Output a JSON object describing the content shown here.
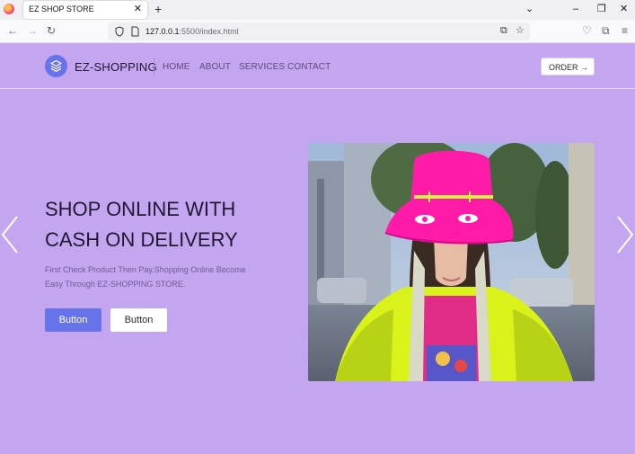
{
  "browser": {
    "tab_title": "EZ SHOP STORE",
    "tab_close": "✕",
    "new_tab": "+",
    "url_host": "127.0.0.1",
    "url_rest": ":5500/index.html",
    "window_controls": [
      "–",
      "❐",
      "✕"
    ]
  },
  "header": {
    "brand": "EZ-SHOPPING",
    "nav": [
      "HOME",
      "ABOUT",
      "SERVICES",
      "CONTACT"
    ],
    "order_label": "ORDER →"
  },
  "hero": {
    "title_line1": "SHOP ONLINE WITH",
    "title_line2": "CASH ON DELIVERY",
    "description": "First Check Product Then Pay.Shopping Online Become Easy Through EZ-SHOPPING STORE.",
    "primary_button": "Button",
    "secondary_button": "Button"
  },
  "carousel": {
    "prev_icon": "chevron-left-icon",
    "next_icon": "chevron-right-icon"
  },
  "colors": {
    "page_bg": "#c4a5f0",
    "accent": "#6773ea",
    "hat": "#ff1aa8",
    "jacket": "#d8f21a"
  }
}
